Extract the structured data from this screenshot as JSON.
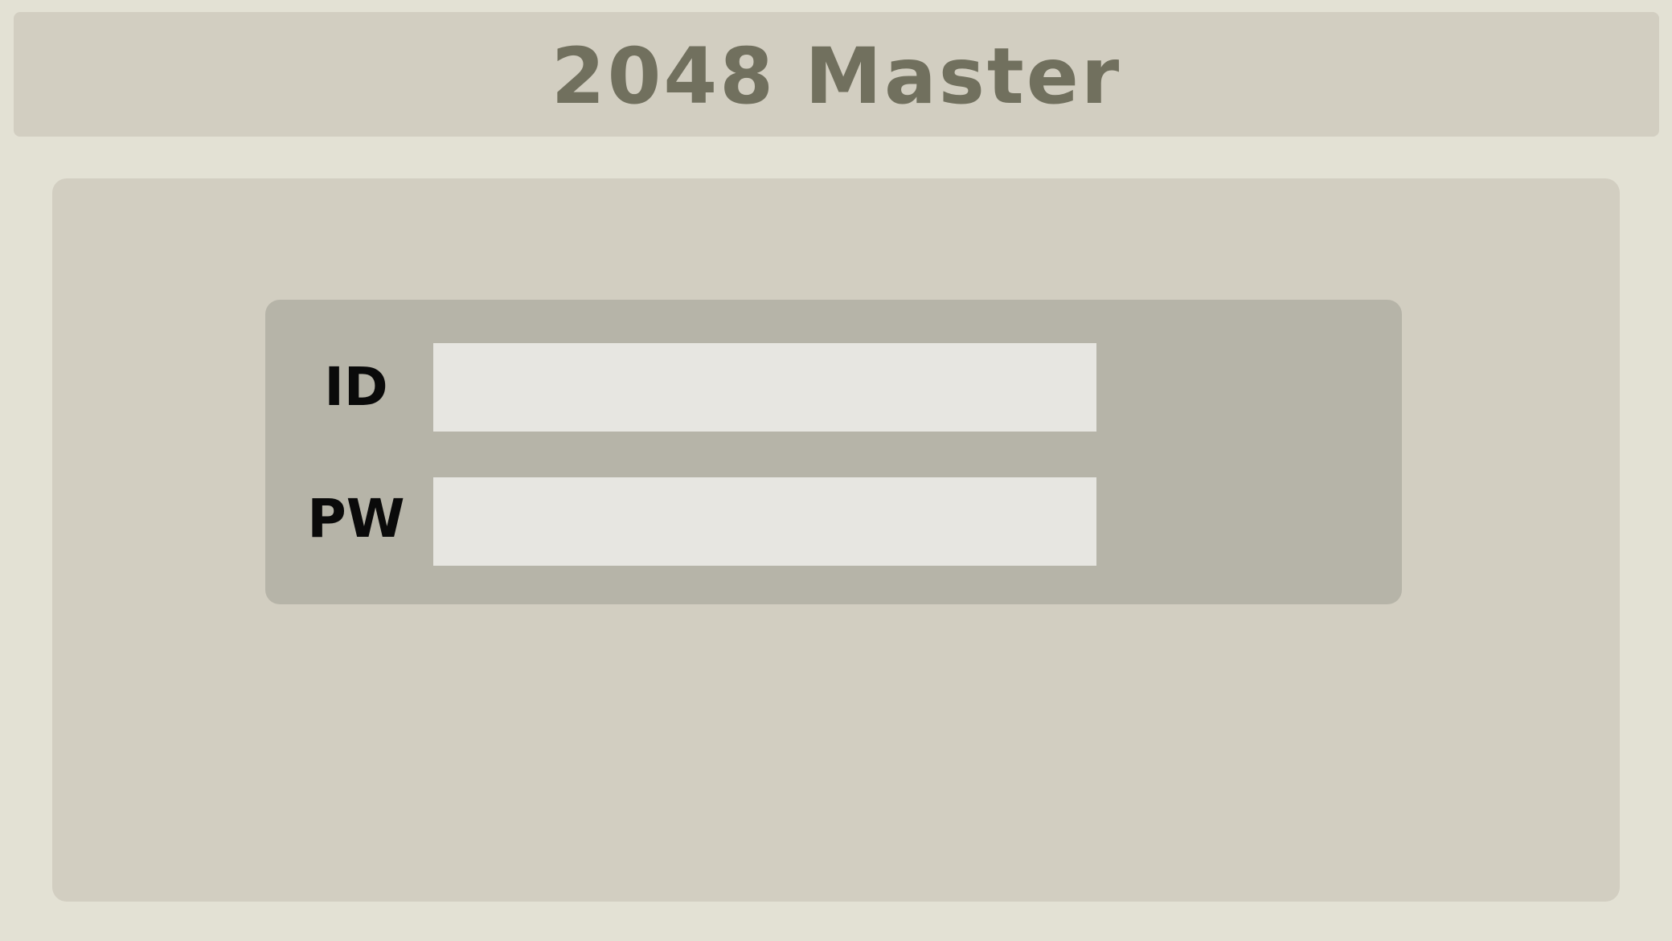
{
  "header": {
    "title": "2048 Master"
  },
  "login": {
    "id_label": "ID",
    "pw_label": "PW",
    "id_value": "",
    "pw_value": ""
  },
  "colors": {
    "page_background": "#e3e1d4",
    "panel_background": "#d2cec1",
    "login_box_background": "#b6b4a8",
    "input_background": "#e7e6e1",
    "title_color": "#71705e",
    "label_color": "#0a0a0a"
  }
}
